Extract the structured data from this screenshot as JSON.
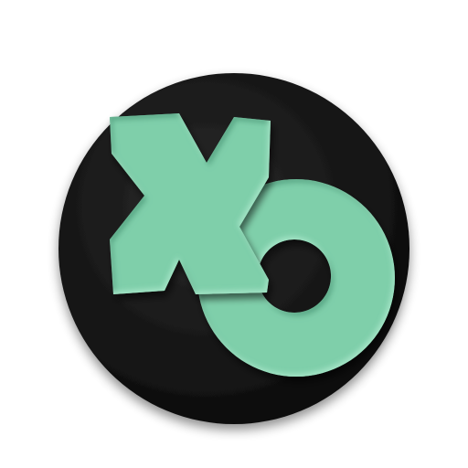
{
  "app_icon": {
    "name": "xo-game-icon",
    "glyphs": [
      "X",
      "O"
    ],
    "colors": {
      "badge": "#0a0a0a",
      "badge_highlight": "#2a2a2a",
      "accent": "#7fcfaa",
      "accent_light": "#a6e6c8",
      "accent_dark": "#4f9d7c",
      "background": "#ffffff"
    }
  }
}
